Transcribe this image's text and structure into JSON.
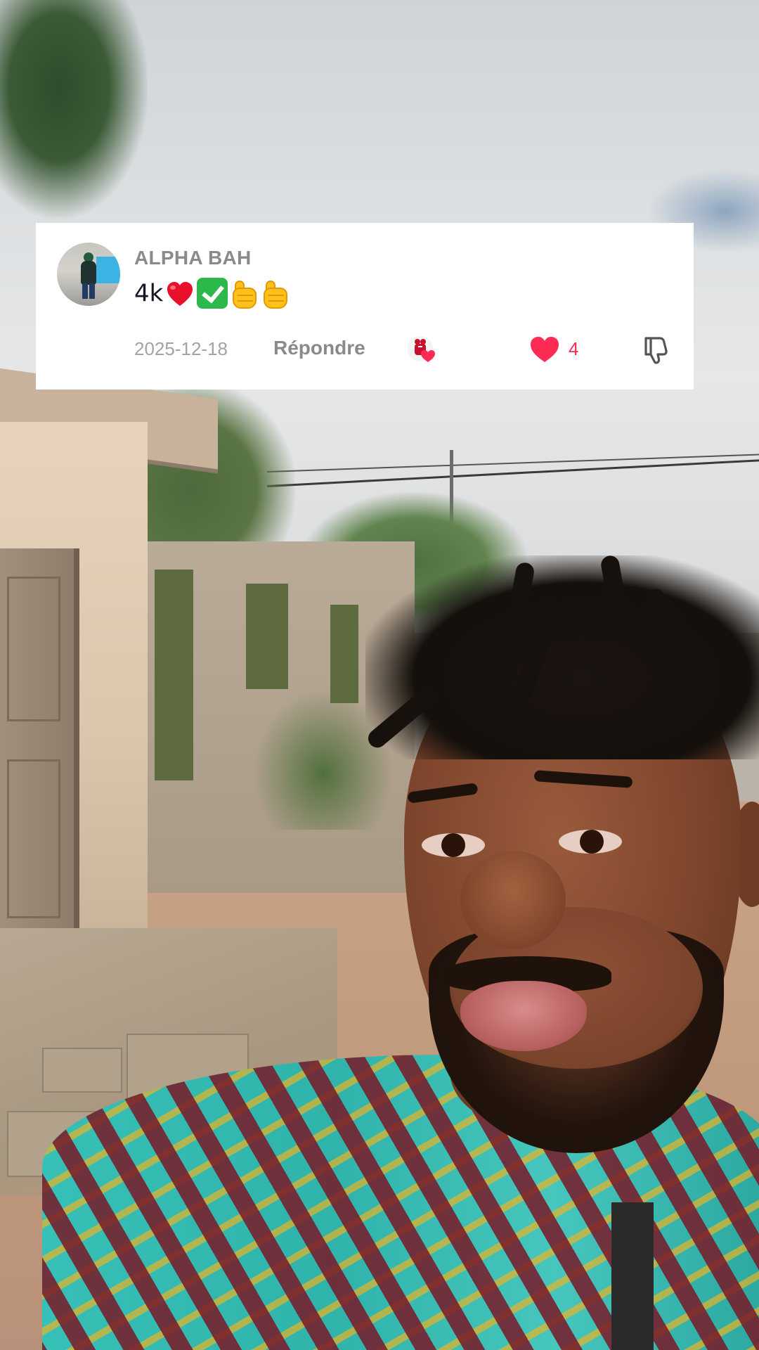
{
  "comment": {
    "username": "ALPHA BAH",
    "text_prefix": "4k",
    "emojis": [
      "red-heart",
      "check-mark-button",
      "raised-fist",
      "raised-fist"
    ],
    "date": "2025-12-18",
    "reply_label": "Répondre",
    "like_count": "4",
    "liked": true
  },
  "colors": {
    "like_red": "#fe2c55",
    "meta_gray": "#8a8a8a",
    "card_bg": "#ffffff",
    "text_dark": "#161823"
  },
  "icons": {
    "avatar": "user-avatar-photo",
    "creator_liked": "creator-liked-badge-icon",
    "like": "heart-icon",
    "dislike": "thumbs-down-icon"
  }
}
